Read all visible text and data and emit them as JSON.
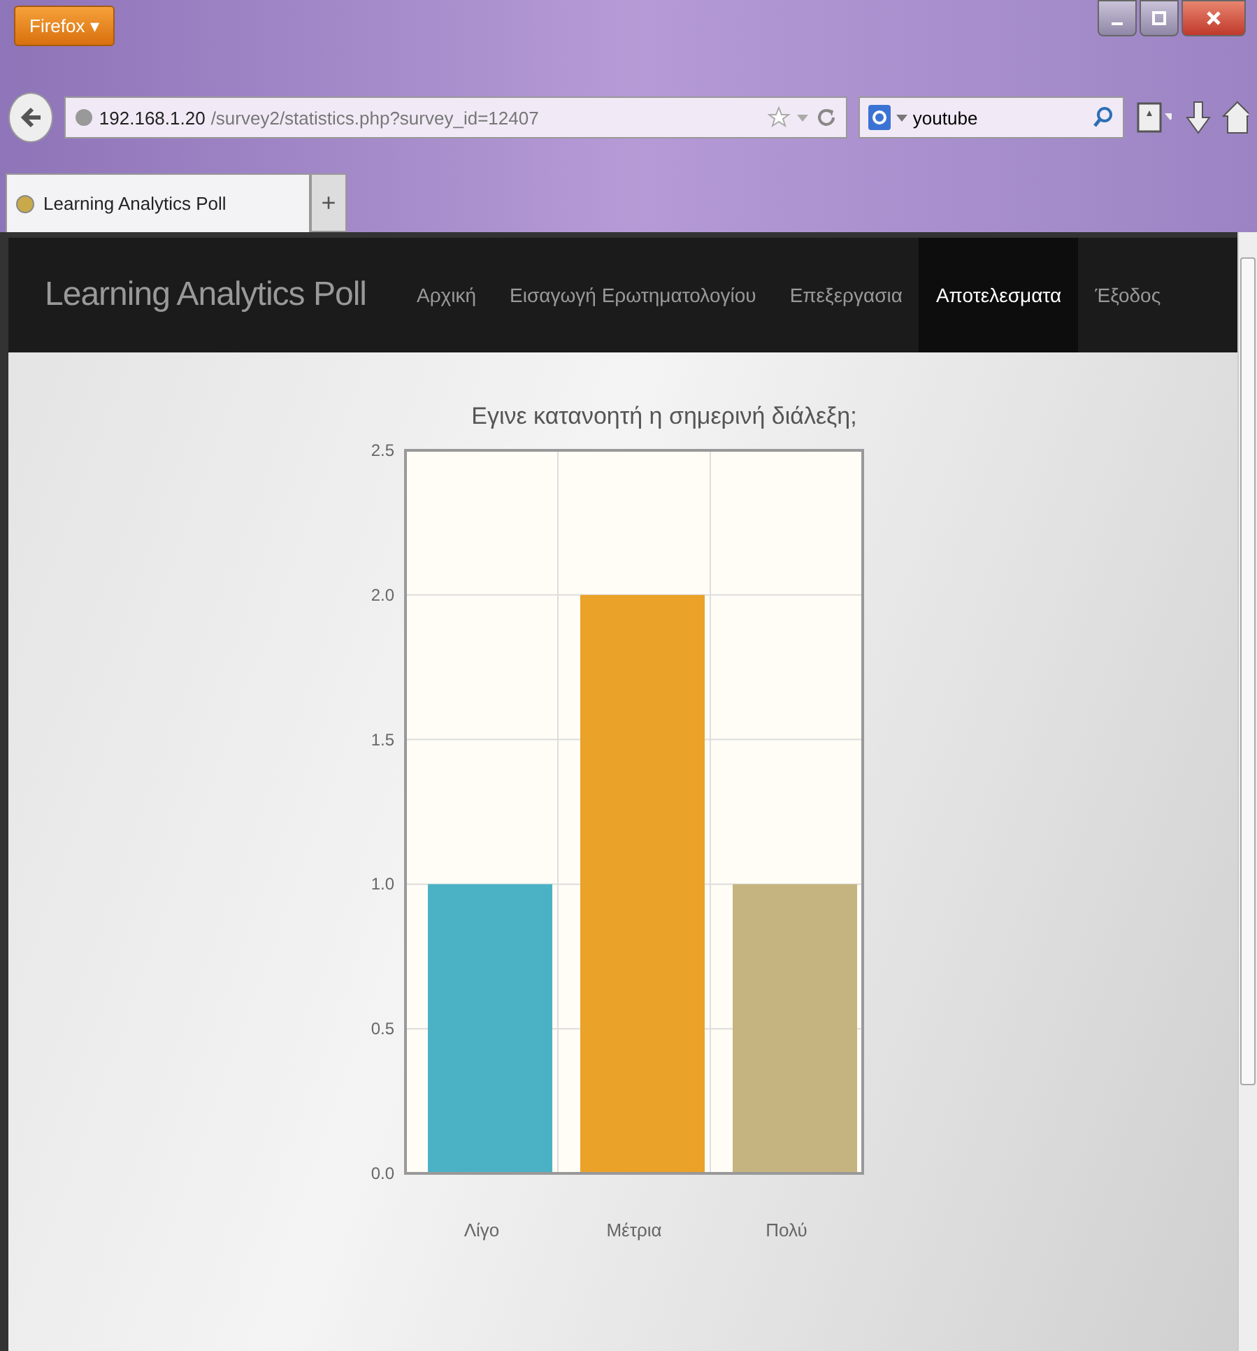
{
  "browser": {
    "menu_button": "Firefox ▾",
    "address": {
      "host": "192.168.1.20",
      "path": "/survey2/statistics.php?survey_id=12407"
    },
    "search": {
      "value": "youtube"
    },
    "tabs": [
      {
        "label": "Learning Analytics Poll",
        "selected": true
      }
    ],
    "new_tab": "+"
  },
  "navbar": {
    "brand": "Learning Analytics Poll",
    "items": [
      {
        "label": "Αρχική",
        "selected": false
      },
      {
        "label": "Εισαγωγή Ερωτηματολογίου",
        "selected": false
      },
      {
        "label": "Επεξεργασια",
        "selected": false
      },
      {
        "label": "Αποτελεσματα",
        "selected": true
      },
      {
        "label": "Έξοδος",
        "selected": false
      }
    ]
  },
  "chart": {
    "chart_data": {
      "type": "bar",
      "title": "Εγινε κατανοητή η σημερινή διάλεξη;",
      "categories": [
        "Λίγο",
        "Μέτρια",
        "Πολύ"
      ],
      "series": [
        {
          "color": "#4bb2c5",
          "values": [
            1,
            null,
            null
          ]
        },
        {
          "color": "#eaa228",
          "values": [
            null,
            2,
            null
          ]
        },
        {
          "color": "#c5b47f",
          "values": [
            null,
            null,
            1
          ]
        }
      ],
      "stacked": true,
      "grid": true,
      "ylim": [
        0,
        2.5
      ],
      "yticks": [
        {
          "value": 0,
          "label": "0.0"
        },
        {
          "value": 0.5,
          "label": "0.5"
        },
        {
          "value": 1,
          "label": "1.0"
        },
        {
          "value": 1.5,
          "label": "1.5"
        },
        {
          "value": 2,
          "label": "2.0"
        },
        {
          "value": 2.5,
          "label": "2.5"
        }
      ]
    }
  }
}
